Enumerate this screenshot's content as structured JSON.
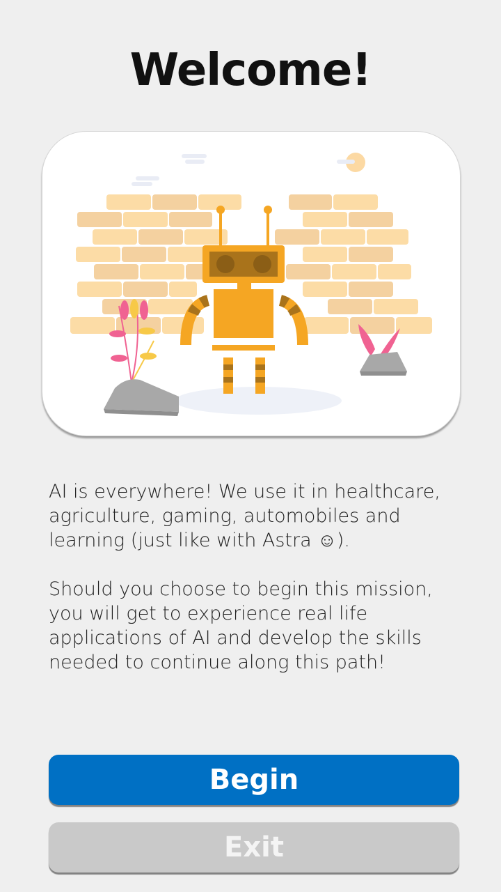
{
  "header": {
    "title": "Welcome!"
  },
  "illustration": {
    "subject": "robot-mascot"
  },
  "intro": {
    "paragraph1": "AI is everywhere! We use it in healthcare, agriculture, gaming, automobiles and learning (just like with Astra ☺).",
    "paragraph2": "Should you choose to begin this mission, you will get to experience real life applications of AI and develop the skills needed to continue along this path!"
  },
  "actions": {
    "begin_label": "Begin",
    "exit_label": "Exit"
  },
  "colors": {
    "begin_button": "#0070c4",
    "exit_button": "#c9c9c9",
    "robot": "#f5a623",
    "bricks": "#fcdca6"
  }
}
